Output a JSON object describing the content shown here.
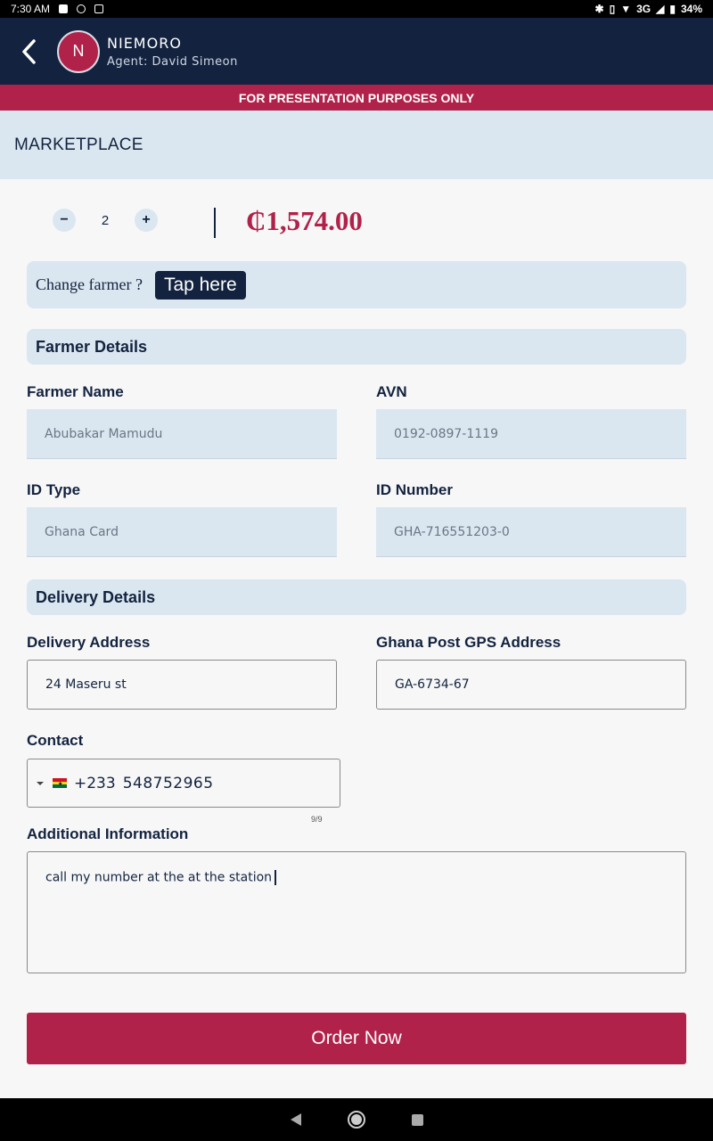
{
  "status_bar": {
    "time": "7:30 AM",
    "network": "3G",
    "battery": "34%"
  },
  "header": {
    "avatar_letter": "N",
    "title": "NIEMORO",
    "subtitle": "Agent: David Simeon"
  },
  "banner": "FOR PRESENTATION PURPOSES ONLY",
  "section_title": "MARKETPLACE",
  "quantity": {
    "minus": "−",
    "value": "2",
    "plus": "+"
  },
  "price": "₵1,574.00",
  "change_farmer": {
    "label": "Change farmer ?",
    "button": "Tap here"
  },
  "farmer_details": {
    "header": "Farmer Details",
    "farmer_name_label": "Farmer Name",
    "farmer_name_value": "Abubakar Mamudu",
    "avn_label": "AVN",
    "avn_value": "0192-0897-1119",
    "id_type_label": "ID Type",
    "id_type_value": "Ghana Card",
    "id_number_label": "ID Number",
    "id_number_value": "GHA-716551203-0"
  },
  "delivery_details": {
    "header": "Delivery Details",
    "address_label": "Delivery Address",
    "address_value": "24 Maseru st",
    "gps_label": "Ghana Post GPS Address",
    "gps_value": "GA-6734-67",
    "contact_label": "Contact",
    "dial_code": "+233",
    "phone_number": "548752965",
    "phone_counter": "9/9",
    "additional_label": "Additional Information",
    "additional_value": "call my number at the at the station"
  },
  "order_button": "Order Now",
  "colors": {
    "navy": "#13233f",
    "crimson": "#b1224a",
    "light_blue": "#dbe7f0"
  }
}
